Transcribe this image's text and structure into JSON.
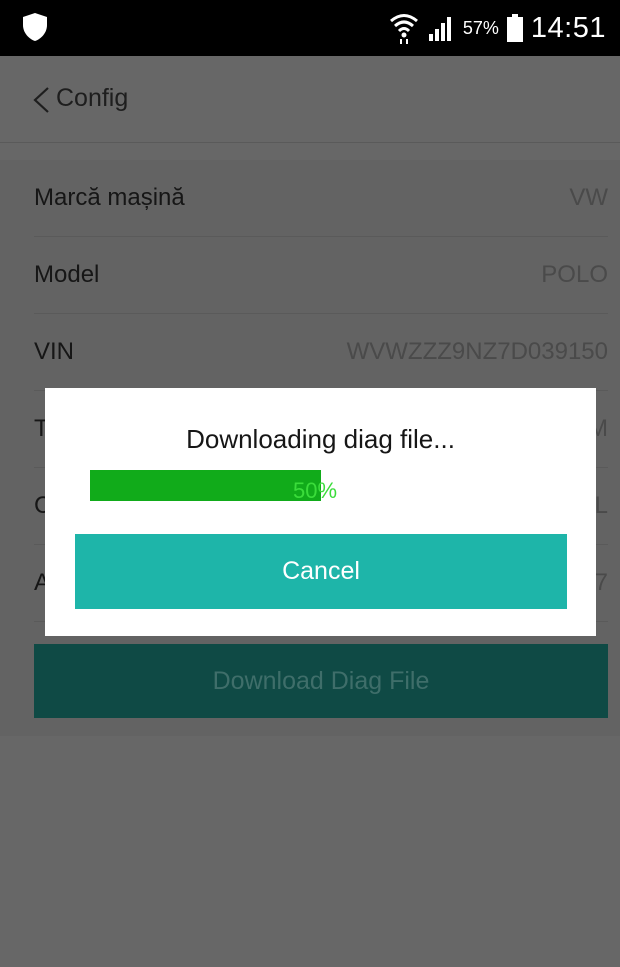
{
  "status_bar": {
    "battery_percent": "57%",
    "time": "14:51",
    "icons": [
      "shield-icon",
      "wifi-icon",
      "signal-icon",
      "battery-icon"
    ]
  },
  "header": {
    "back_icon": "chevron-left-icon",
    "title": "Config"
  },
  "list": {
    "rows": [
      {
        "label": "Marcă mașină",
        "value": "VW"
      },
      {
        "label": "Model",
        "value": "POLO"
      },
      {
        "label": "VIN",
        "value": "WVWZZZ9NZ7D039150"
      },
      {
        "label": "T",
        "value": "M"
      },
      {
        "label": "C",
        "value": "L"
      },
      {
        "label": "A",
        "value": "7"
      }
    ]
  },
  "download_button": {
    "label": "Download Diag File"
  },
  "dialog": {
    "title": "Downloading diag file...",
    "progress_value": 50,
    "progress_text": "50%",
    "cancel_label": "Cancel"
  },
  "colors": {
    "accent": "#1eb5a9",
    "progress": "#11ab1a",
    "button_dark": "#0f4a45"
  }
}
